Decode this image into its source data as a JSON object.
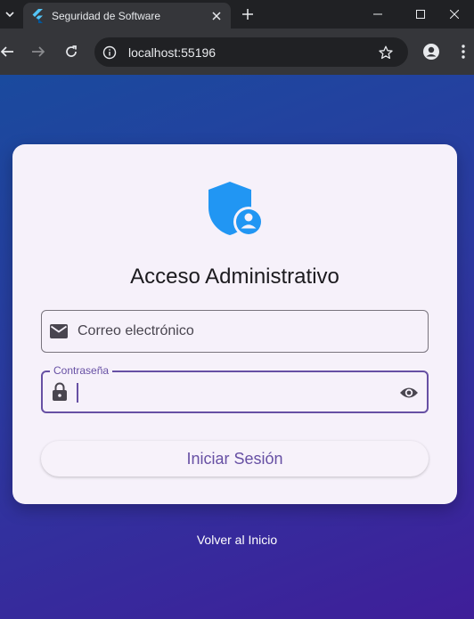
{
  "browser": {
    "tab_title": "Seguridad de Software",
    "url": "localhost:55196",
    "icons": [
      "tab-list-icon",
      "flutter-favicon",
      "close-icon",
      "plus-icon",
      "minimize-icon",
      "maximize-icon",
      "close-window-icon",
      "back-arrow-icon",
      "forward-arrow-icon",
      "reload-icon",
      "site-info-icon",
      "star-icon",
      "profile-icon",
      "more-vert-icon"
    ]
  },
  "login": {
    "title": "Acceso Administrativo",
    "email_placeholder": "Correo electrónico",
    "password_label": "Contraseña",
    "password_value": "",
    "submit_label": "Iniciar Sesión",
    "back_link": "Volver al Inicio"
  },
  "colors": {
    "primary": "#6750a4",
    "shield": "#2196f3",
    "card_bg": "#f6f1fa",
    "gradient_start": "#1a4a9e",
    "gradient_end": "#3f1e99"
  }
}
